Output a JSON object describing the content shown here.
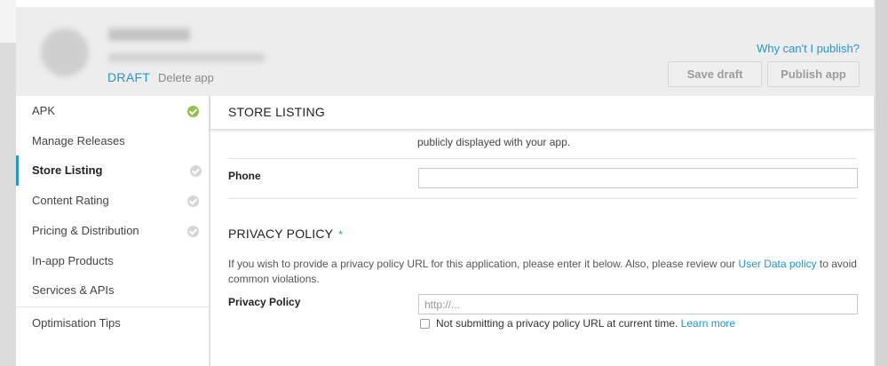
{
  "header": {
    "status_label": "DRAFT",
    "delete_label": "Delete app",
    "why_link": "Why can't I publish?",
    "save_draft_label": "Save draft",
    "publish_label": "Publish app"
  },
  "sidebar": {
    "items": [
      {
        "label": "APK",
        "status": "complete"
      },
      {
        "label": "Manage Releases"
      },
      {
        "label": "Store Listing",
        "status": "incomplete",
        "active": true
      },
      {
        "label": "Content Rating",
        "status": "incomplete"
      },
      {
        "label": "Pricing & Distribution",
        "status": "incomplete"
      },
      {
        "label": "In-app Products"
      },
      {
        "label": "Services & APIs"
      },
      {
        "label": "Optimisation Tips"
      }
    ]
  },
  "main": {
    "section_title": "STORE LISTING",
    "helper_text": "publicly displayed with your app.",
    "phone_label": "Phone",
    "phone_value": "",
    "privacy_heading": "PRIVACY POLICY",
    "required_marker": "*",
    "privacy_desc": "If you wish to provide a privacy policy URL for this application, please enter it below. Also, please review our",
    "user_data_link": "User Data policy",
    "privacy_desc_end": "to avoid common violations.",
    "privacy_label": "Privacy Policy",
    "privacy_placeholder": "http://...",
    "privacy_value": "",
    "checkbox_label": "Not submitting a privacy policy URL at current time.",
    "checkbox_checked": false,
    "learn_more": "Learn more"
  },
  "colors": {
    "accent": "#2196d3",
    "complete": "#8bc34a",
    "incomplete": "#d6d6d6"
  }
}
